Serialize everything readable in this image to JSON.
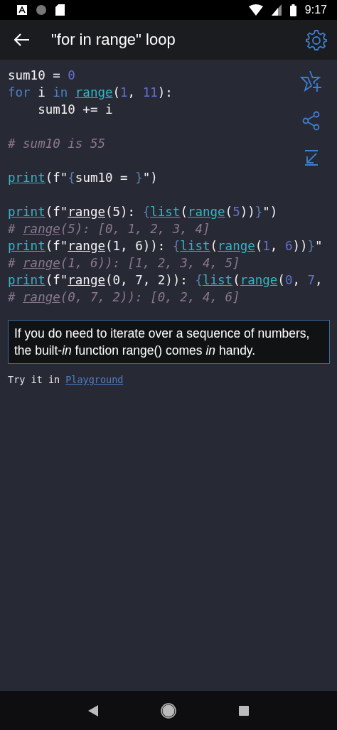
{
  "status_bar": {
    "time": "9:17"
  },
  "app_bar": {
    "title": "\"for in range\" loop"
  },
  "code_blocks": [
    [
      {
        "tokens": [
          {
            "text": "sum10 = ",
            "kind": "plain"
          },
          {
            "text": "0",
            "kind": "number"
          }
        ]
      },
      {
        "tokens": [
          {
            "text": "for",
            "kind": "keyword"
          },
          {
            "text": " i ",
            "kind": "plain"
          },
          {
            "text": "in ",
            "kind": "keyword"
          },
          {
            "text": "range",
            "kind": "call"
          },
          {
            "text": "(",
            "kind": "plain"
          },
          {
            "text": "1",
            "kind": "number"
          },
          {
            "text": ", ",
            "kind": "plain"
          },
          {
            "text": "11",
            "kind": "number"
          },
          {
            "text": "):",
            "kind": "plain"
          }
        ]
      },
      {
        "tokens": [
          {
            "text": "    sum10 += i",
            "kind": "plain"
          }
        ]
      }
    ],
    [
      {
        "tokens": [
          {
            "text": "# sum10 is 55",
            "kind": "comment"
          }
        ]
      }
    ],
    [
      {
        "tokens": [
          {
            "text": "print",
            "kind": "call"
          },
          {
            "text": "(f\"",
            "kind": "plain"
          },
          {
            "text": "{",
            "kind": "brace"
          },
          {
            "text": "sum10 = ",
            "kind": "plain"
          },
          {
            "text": "}",
            "kind": "brace"
          },
          {
            "text": "\")",
            "kind": "plain"
          }
        ]
      }
    ],
    [
      {
        "tokens": [
          {
            "text": "print",
            "kind": "call"
          },
          {
            "text": "(f\"",
            "kind": "plain"
          },
          {
            "text": "range",
            "kind": "ref"
          },
          {
            "text": "(5): ",
            "kind": "plain"
          },
          {
            "text": "{",
            "kind": "brace"
          },
          {
            "text": "list",
            "kind": "call"
          },
          {
            "text": "(",
            "kind": "plain"
          },
          {
            "text": "range",
            "kind": "call"
          },
          {
            "text": "(",
            "kind": "plain"
          },
          {
            "text": "5",
            "kind": "number"
          },
          {
            "text": "))",
            "kind": "plain"
          },
          {
            "text": "}",
            "kind": "brace"
          },
          {
            "text": "\")",
            "kind": "plain"
          }
        ]
      },
      {
        "tokens": [
          {
            "text": "# ",
            "kind": "comment"
          },
          {
            "text": "range",
            "kind": "comment_ref"
          },
          {
            "text": "(5): [0, 1, 2, 3, 4]",
            "kind": "comment"
          }
        ]
      },
      {
        "tokens": [
          {
            "text": "print",
            "kind": "call"
          },
          {
            "text": "(f\"",
            "kind": "plain"
          },
          {
            "text": "range",
            "kind": "ref"
          },
          {
            "text": "(1, 6)): ",
            "kind": "plain"
          },
          {
            "text": "{",
            "kind": "brace"
          },
          {
            "text": "list",
            "kind": "call"
          },
          {
            "text": "(",
            "kind": "plain"
          },
          {
            "text": "range",
            "kind": "call"
          },
          {
            "text": "(",
            "kind": "plain"
          },
          {
            "text": "1",
            "kind": "number"
          },
          {
            "text": ", ",
            "kind": "plain"
          },
          {
            "text": "6",
            "kind": "number"
          },
          {
            "text": "))",
            "kind": "plain"
          },
          {
            "text": "}",
            "kind": "brace"
          },
          {
            "text": "\"",
            "kind": "plain"
          }
        ]
      },
      {
        "tokens": [
          {
            "text": "# ",
            "kind": "comment"
          },
          {
            "text": "range",
            "kind": "comment_ref"
          },
          {
            "text": "(1, 6)): [1, 2, 3, 4, 5]",
            "kind": "comment"
          }
        ]
      },
      {
        "tokens": [
          {
            "text": "print",
            "kind": "call"
          },
          {
            "text": "(f\"",
            "kind": "plain"
          },
          {
            "text": "range",
            "kind": "ref"
          },
          {
            "text": "(0, 7, 2)): ",
            "kind": "plain"
          },
          {
            "text": "{",
            "kind": "brace"
          },
          {
            "text": "list",
            "kind": "call"
          },
          {
            "text": "(",
            "kind": "plain"
          },
          {
            "text": "range",
            "kind": "call"
          },
          {
            "text": "(",
            "kind": "plain"
          },
          {
            "text": "0",
            "kind": "number"
          },
          {
            "text": ", ",
            "kind": "plain"
          },
          {
            "text": "7",
            "kind": "number"
          },
          {
            "text": ",",
            "kind": "plain"
          }
        ]
      },
      {
        "tokens": [
          {
            "text": "# ",
            "kind": "comment"
          },
          {
            "text": "range",
            "kind": "comment_ref"
          },
          {
            "text": "(0, 7, 2)): [0, 2, 4, 6]",
            "kind": "comment"
          }
        ]
      }
    ]
  ],
  "note": "If you do need to iterate over a sequence of numbers, the built-*in* function range() comes *in* handy.",
  "try_line": {
    "text": "Try it in",
    "link": "Playground"
  }
}
